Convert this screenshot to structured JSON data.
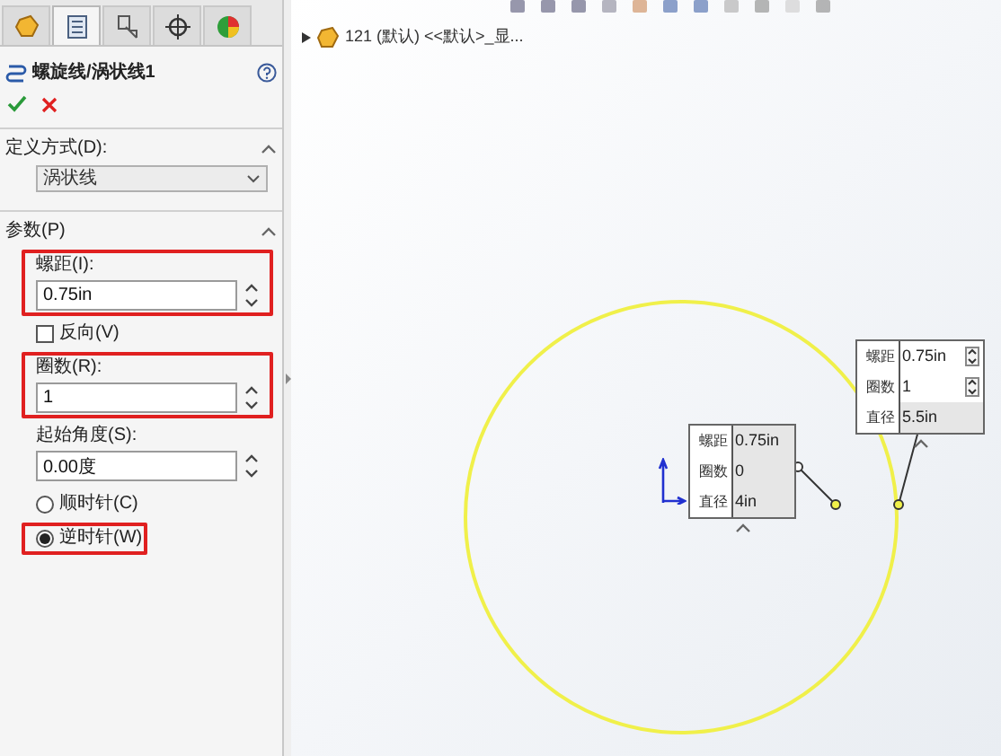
{
  "panel_tabs": [
    {
      "kind": "part",
      "selected": false
    },
    {
      "kind": "list",
      "selected": true
    },
    {
      "kind": "config",
      "selected": false
    },
    {
      "kind": "target",
      "selected": false
    },
    {
      "kind": "appearance",
      "selected": false
    }
  ],
  "feature": {
    "title": "螺旋线/涡状线1"
  },
  "sections": [
    {
      "title": "定义方式(D):",
      "expanded": true
    },
    {
      "title": "参数(P)",
      "expanded": true
    }
  ],
  "define_by": {
    "value": "涡状线"
  },
  "params": [
    {
      "kind": "field",
      "label": "螺距(I):",
      "value": "0.75in",
      "highlighted": true
    },
    {
      "kind": "checkbox",
      "label": "反向(V)",
      "checked": false,
      "highlighted": false
    },
    {
      "kind": "field",
      "label": "圈数(R):",
      "value": "1",
      "highlighted": true
    },
    {
      "kind": "field",
      "label": "起始角度(S):",
      "value": "0.00度",
      "highlighted": false
    },
    {
      "kind": "radio",
      "label": "顺时针(C)",
      "selected": false,
      "highlighted": false
    },
    {
      "kind": "radio",
      "label": "逆时针(W)",
      "selected": true,
      "highlighted": true
    }
  ],
  "tree": {
    "item": "121 (默认) <<默认>_显..."
  },
  "callouts": [
    {
      "rows": [
        {
          "label": "螺距",
          "value": "0.75in",
          "spinner": false
        },
        {
          "label": "圈数",
          "value": "0",
          "spinner": false
        },
        {
          "label": "直径",
          "value": "4in",
          "spinner": false
        }
      ]
    },
    {
      "rows": [
        {
          "label": "螺距",
          "value": "0.75in",
          "spinner": true
        },
        {
          "label": "圈数",
          "value": "1",
          "spinner": true
        },
        {
          "label": "直径",
          "value": "5.5in",
          "spinner": false
        }
      ]
    }
  ]
}
